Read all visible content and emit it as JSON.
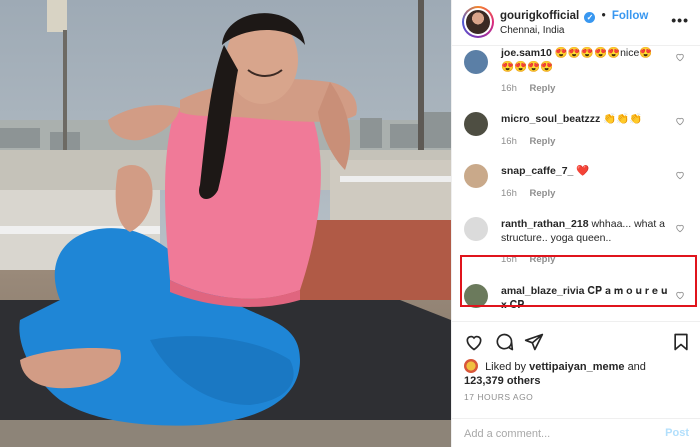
{
  "post": {
    "username": "gourigkofficial",
    "follow_label": "Follow",
    "location": "Chennai, India",
    "more_label": "•••"
  },
  "comments": [
    {
      "username": "joe.sam10",
      "text": "😍😍😍😍😍nice😍",
      "text2": "😍😍😍😍",
      "time": "16h",
      "reply": "Reply",
      "avatar_color": "#5b7fa6"
    },
    {
      "username": "micro_soul_beatzzz",
      "text": "👏👏👏",
      "time": "16h",
      "reply": "Reply",
      "avatar_color": "#4e4e42"
    },
    {
      "username": "snap_caffe_7_",
      "text": "❤️",
      "time": "16h",
      "reply": "Reply",
      "avatar_color": "#c9a98a"
    },
    {
      "username": "ranth_rathan_218",
      "text": "whhaa... what a structure.. yoga queen..",
      "time": "16h",
      "reply": "Reply",
      "avatar_color": "#dbdbdb"
    },
    {
      "username": "amal_blaze_rivia",
      "text": "𝐂𝐏 𝐚 𝐦 𝐨 𝐮 𝐫 𝐞 𝐮 𝐱 𝐂𝐏",
      "time": "",
      "reply": "",
      "avatar_color": "#6b7a5c"
    }
  ],
  "likes": {
    "prefix": "Liked by",
    "liker": "vettipaiyan_meme",
    "joiner": "and",
    "count": "123,379 others"
  },
  "timestamp": "17 HOURS AGO",
  "composer": {
    "placeholder": "Add a comment...",
    "post_label": "Post"
  },
  "colors": {
    "link_blue": "#3897f0",
    "highlight_red": "#e0141c",
    "pants_blue": "#1f86d6",
    "shirt_pink": "#f07a98"
  },
  "icons": [
    "verified-badge-icon",
    "more-options-icon",
    "heart-icon",
    "comment-icon",
    "share-icon",
    "bookmark-icon"
  ]
}
